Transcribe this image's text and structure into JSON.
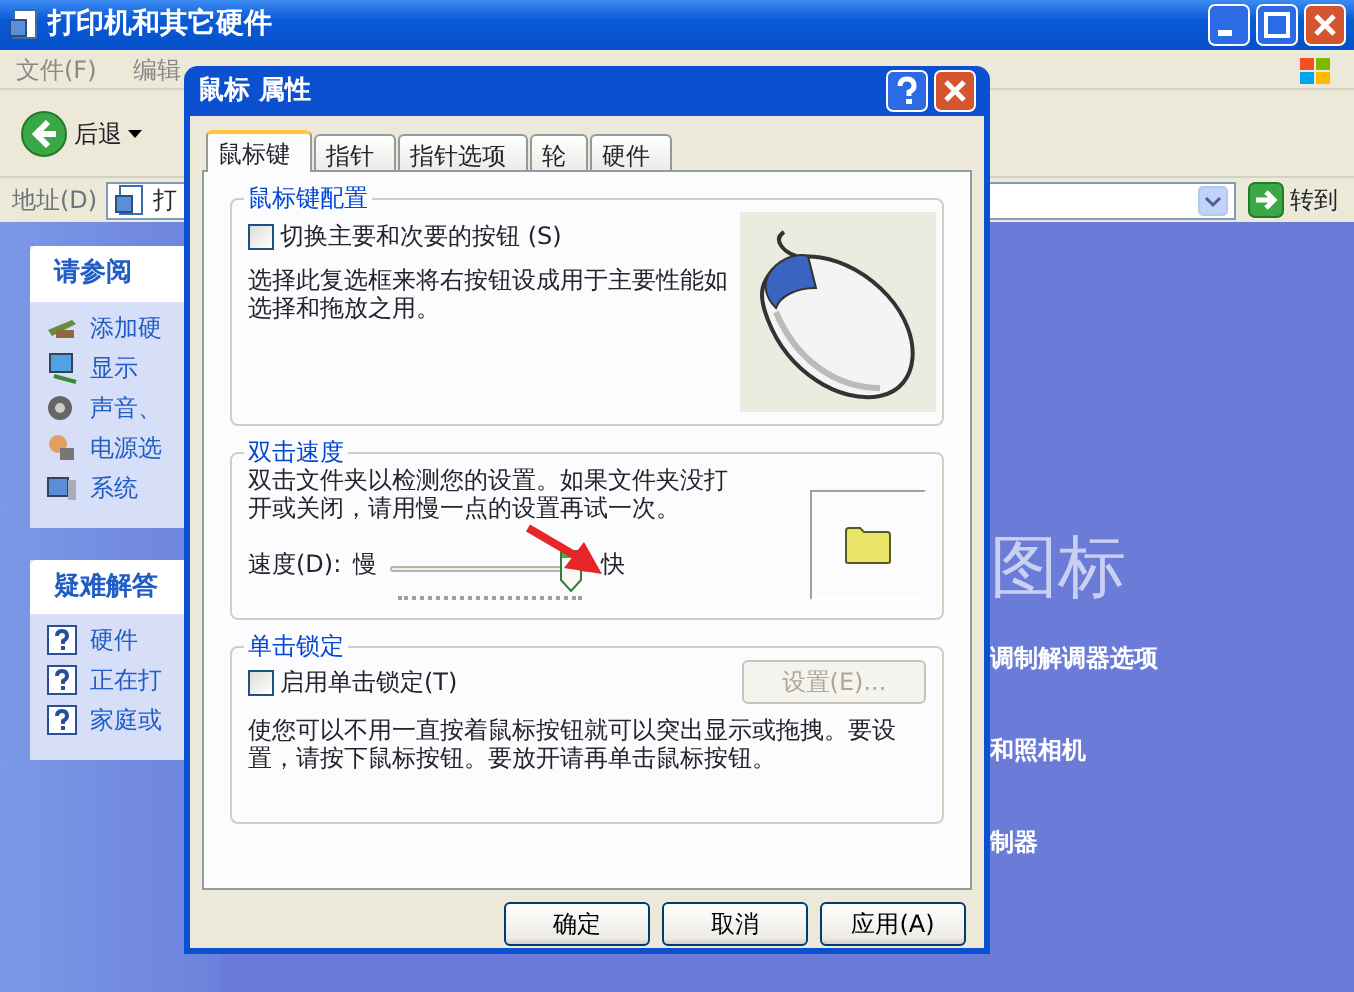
{
  "window": {
    "title": "打印机和其它硬件"
  },
  "menu": [
    "文件(F)",
    "编辑"
  ],
  "toolbar": {
    "back": "后退"
  },
  "address": {
    "label": "地址(D)",
    "value": "打",
    "go": "转到"
  },
  "sidebar": [
    {
      "title": "请参阅",
      "items": [
        {
          "kind": "hardware",
          "label": "添加硬"
        },
        {
          "kind": "display",
          "label": "显示"
        },
        {
          "kind": "sound",
          "label": "声音、"
        },
        {
          "kind": "power",
          "label": "电源选"
        },
        {
          "kind": "system",
          "label": "系统"
        }
      ]
    },
    {
      "title": "疑难解答",
      "items": [
        {
          "kind": "help",
          "label": "硬件"
        },
        {
          "kind": "help",
          "label": "正在打"
        },
        {
          "kind": "help",
          "label": "家庭或"
        }
      ]
    }
  ],
  "content": {
    "heading": "图标",
    "links": [
      "调制解调器选项",
      "和照相机",
      "制器"
    ]
  },
  "dialog": {
    "title": "鼠标 属性",
    "tabs": [
      {
        "label": "鼠标键",
        "selected": true
      },
      {
        "label": "指针",
        "selected": false
      },
      {
        "label": "指针选项",
        "selected": false
      },
      {
        "label": "轮",
        "selected": false
      },
      {
        "label": "硬件",
        "selected": false
      }
    ],
    "button_config": {
      "title": "鼠标键配置",
      "checkbox": {
        "label": "切换主要和次要的按钮 (S)",
        "checked": false
      },
      "description": "选择此复选框来将右按钮设成用于主要性能如选择和拖放之用。"
    },
    "double_click": {
      "title": "双击速度",
      "description": "双击文件夹以检测您的设置。如果文件夹没打开或关闭，请用慢一点的设置再试一次。",
      "speed_label": "速度(D):",
      "slow": "慢",
      "fast": "快",
      "level": 0.9
    },
    "click_lock": {
      "title": "单击锁定",
      "checkbox": {
        "label": "启用单击锁定(T)",
        "checked": false
      },
      "settings_button": {
        "label": "设置(E)...",
        "disabled": true
      },
      "description": "使您可以不用一直按着鼠标按钮就可以突出显示或拖拽。要设置，请按下鼠标按钮。要放开请再单击鼠标按钮。"
    },
    "buttons": [
      "确定",
      "取消",
      "应用(A)"
    ]
  }
}
